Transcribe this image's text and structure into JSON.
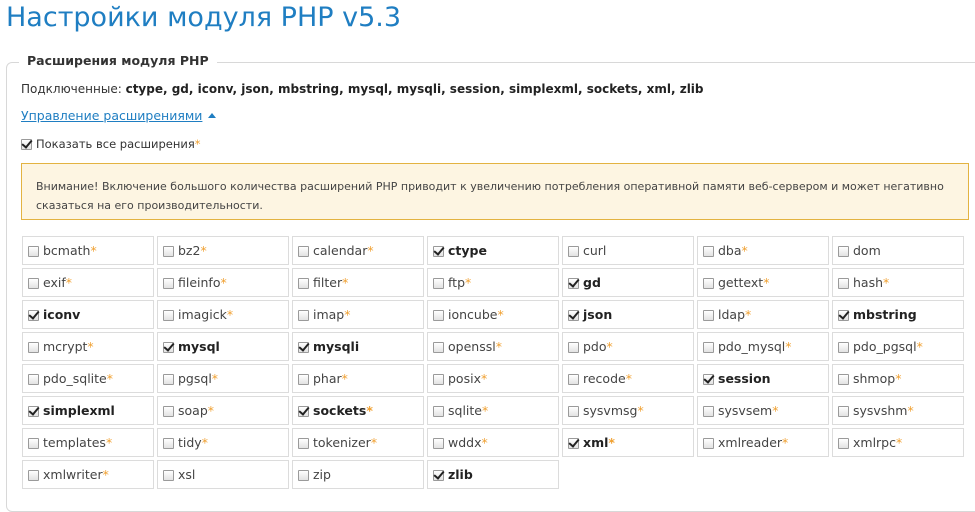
{
  "page": {
    "title": "Настройки модуля PHP v5.3"
  },
  "section": {
    "legend": "Расширения модуля PHP",
    "enabled_label": "Подключенные:",
    "enabled_list": "ctype, gd, iconv, json, mbstring, mysql, mysqli, session, simplexml, sockets, xml, zlib",
    "manage_link": "Управление расширениями",
    "show_all_label": "Показать все расширения",
    "show_all_checked": true,
    "warning": "Внимание! Включение большого количества расширений PHP приводит к увеличению потребления оперативной памяти веб-сервером и может негативно сказаться на его производительности."
  },
  "colors": {
    "title": "#1f7ec2",
    "link": "#1f7ec2",
    "star": "#f0a030",
    "warning_bg": "#fdf5e2",
    "warning_border": "#e3b341"
  },
  "extensions": [
    {
      "name": "bcmath",
      "checked": false,
      "star": true
    },
    {
      "name": "bz2",
      "checked": false,
      "star": true
    },
    {
      "name": "calendar",
      "checked": false,
      "star": true
    },
    {
      "name": "ctype",
      "checked": true,
      "star": false
    },
    {
      "name": "curl",
      "checked": false,
      "star": false
    },
    {
      "name": "dba",
      "checked": false,
      "star": true
    },
    {
      "name": "dom",
      "checked": false,
      "star": false
    },
    {
      "name": "exif",
      "checked": false,
      "star": true
    },
    {
      "name": "fileinfo",
      "checked": false,
      "star": true
    },
    {
      "name": "filter",
      "checked": false,
      "star": true
    },
    {
      "name": "ftp",
      "checked": false,
      "star": true
    },
    {
      "name": "gd",
      "checked": true,
      "star": false
    },
    {
      "name": "gettext",
      "checked": false,
      "star": true
    },
    {
      "name": "hash",
      "checked": false,
      "star": true
    },
    {
      "name": "iconv",
      "checked": true,
      "star": false
    },
    {
      "name": "imagick",
      "checked": false,
      "star": true
    },
    {
      "name": "imap",
      "checked": false,
      "star": true
    },
    {
      "name": "ioncube",
      "checked": false,
      "star": true
    },
    {
      "name": "json",
      "checked": true,
      "star": false
    },
    {
      "name": "ldap",
      "checked": false,
      "star": true
    },
    {
      "name": "mbstring",
      "checked": true,
      "star": false
    },
    {
      "name": "mcrypt",
      "checked": false,
      "star": true
    },
    {
      "name": "mysql",
      "checked": true,
      "star": false
    },
    {
      "name": "mysqli",
      "checked": true,
      "star": false
    },
    {
      "name": "openssl",
      "checked": false,
      "star": true
    },
    {
      "name": "pdo",
      "checked": false,
      "star": true
    },
    {
      "name": "pdo_mysql",
      "checked": false,
      "star": true
    },
    {
      "name": "pdo_pgsql",
      "checked": false,
      "star": true
    },
    {
      "name": "pdo_sqlite",
      "checked": false,
      "star": true
    },
    {
      "name": "pgsql",
      "checked": false,
      "star": true
    },
    {
      "name": "phar",
      "checked": false,
      "star": true
    },
    {
      "name": "posix",
      "checked": false,
      "star": true
    },
    {
      "name": "recode",
      "checked": false,
      "star": true
    },
    {
      "name": "session",
      "checked": true,
      "star": false
    },
    {
      "name": "shmop",
      "checked": false,
      "star": true
    },
    {
      "name": "simplexml",
      "checked": true,
      "star": false
    },
    {
      "name": "soap",
      "checked": false,
      "star": true
    },
    {
      "name": "sockets",
      "checked": true,
      "star": true
    },
    {
      "name": "sqlite",
      "checked": false,
      "star": true
    },
    {
      "name": "sysvmsg",
      "checked": false,
      "star": true
    },
    {
      "name": "sysvsem",
      "checked": false,
      "star": true
    },
    {
      "name": "sysvshm",
      "checked": false,
      "star": true
    },
    {
      "name": "templates",
      "checked": false,
      "star": true
    },
    {
      "name": "tidy",
      "checked": false,
      "star": true
    },
    {
      "name": "tokenizer",
      "checked": false,
      "star": true
    },
    {
      "name": "wddx",
      "checked": false,
      "star": true
    },
    {
      "name": "xml",
      "checked": true,
      "star": true
    },
    {
      "name": "xmlreader",
      "checked": false,
      "star": true
    },
    {
      "name": "xmlrpc",
      "checked": false,
      "star": true
    },
    {
      "name": "xmlwriter",
      "checked": false,
      "star": true
    },
    {
      "name": "xsl",
      "checked": false,
      "star": false
    },
    {
      "name": "zip",
      "checked": false,
      "star": false
    },
    {
      "name": "zlib",
      "checked": true,
      "star": false
    }
  ]
}
